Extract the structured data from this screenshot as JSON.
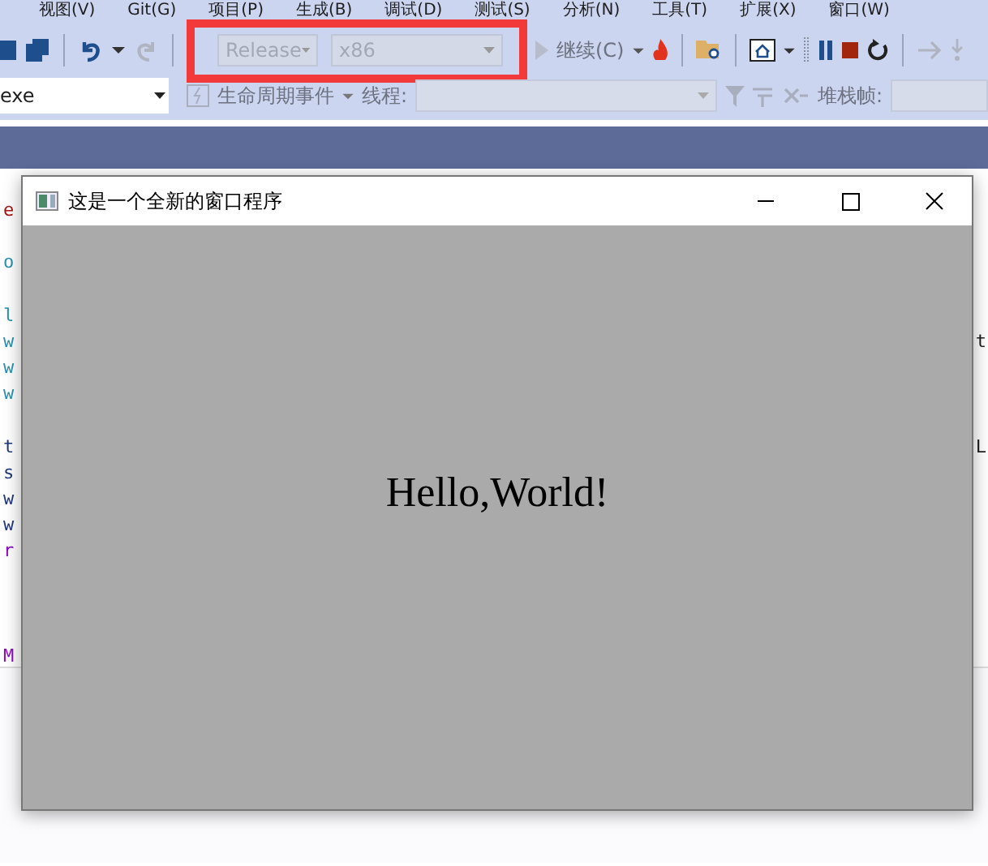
{
  "menu": {
    "items": [
      "视图(V)",
      "Git(G)",
      "项目(P)",
      "生成(B)",
      "调试(D)",
      "测试(S)",
      "分析(N)",
      "工具(T)",
      "扩展(X)",
      "窗口(W)"
    ]
  },
  "toolbar": {
    "configuration": {
      "value": "Release",
      "disabled": true
    },
    "platform": {
      "value": "x86",
      "disabled": true
    },
    "continue_button": {
      "label": "继续(C)"
    }
  },
  "debug_location": {
    "process": {
      "value": "exe"
    },
    "lifecycle_events": {
      "label": "生命周期事件"
    },
    "thread_label": "线程:",
    "stack_frame_label": "堆栈帧:"
  },
  "editor": {
    "lines": [
      {
        "kind": "code",
        "left": "e"
      },
      {
        "kind": "blank"
      },
      {
        "kind": "code",
        "left": "o"
      },
      {
        "kind": "blank"
      },
      {
        "kind": "code",
        "left": "l"
      },
      {
        "kind": "code",
        "left": "w",
        "right": "t"
      },
      {
        "kind": "code",
        "left": "w"
      },
      {
        "kind": "code",
        "left": "w"
      },
      {
        "kind": "blank"
      },
      {
        "kind": "code",
        "left": "t",
        "right": "L"
      },
      {
        "kind": "code",
        "left": "s"
      },
      {
        "kind": "code",
        "left": "w"
      },
      {
        "kind": "code",
        "left": "w"
      },
      {
        "kind": "code",
        "left": "r"
      },
      {
        "kind": "blank"
      },
      {
        "kind": "blank"
      },
      {
        "kind": "blank"
      },
      {
        "kind": "code",
        "left": "M"
      }
    ]
  },
  "window": {
    "title": "这是一个全新的窗口程序",
    "content_text": "Hello,World!"
  }
}
